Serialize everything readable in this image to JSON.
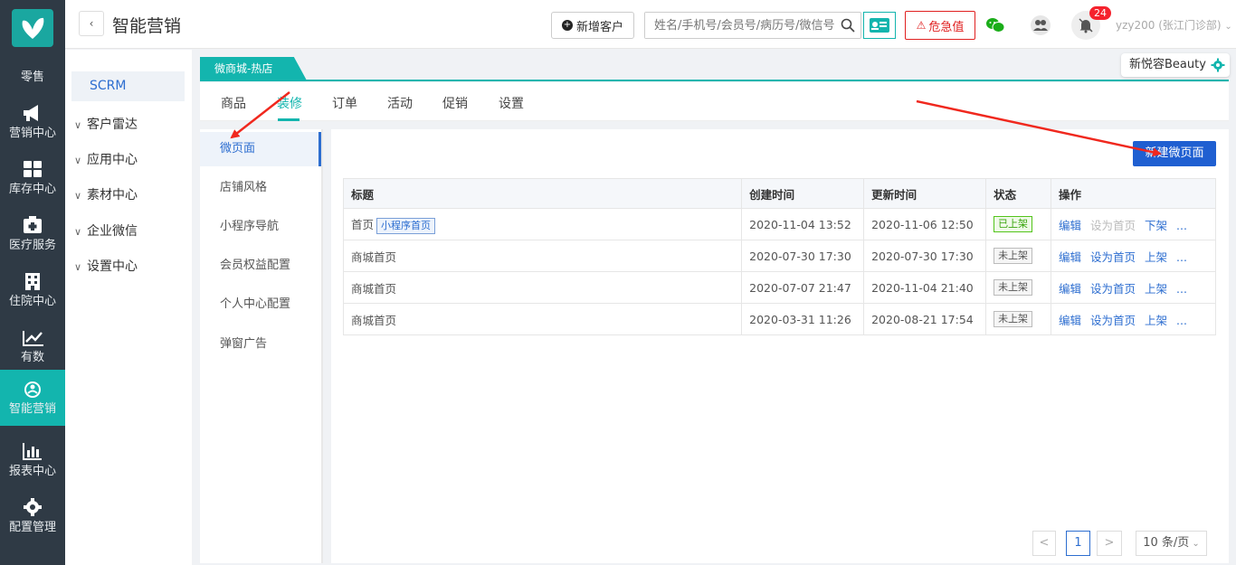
{
  "leftnav": [
    {
      "label": "零售",
      "icon": "retail-icon"
    },
    {
      "label": "营销中心",
      "icon": "megaphone-icon"
    },
    {
      "label": "库存中心",
      "icon": "grid-icon"
    },
    {
      "label": "医疗服务",
      "icon": "medical-kit-icon"
    },
    {
      "label": "住院中心",
      "icon": "building-icon"
    },
    {
      "label": "有数",
      "icon": "trend-icon"
    },
    {
      "label": "智能营销",
      "icon": "smart-marketing-icon"
    },
    {
      "label": "报表中心",
      "icon": "bar-chart-icon"
    },
    {
      "label": "配置管理",
      "icon": "gear-icon"
    }
  ],
  "header": {
    "title": "智能营销",
    "new_customer": "新增客户",
    "search_placeholder": "姓名/手机号/会员号/病历号/微信号",
    "danger_label": "危急值",
    "notification_count": "24",
    "user": "yzy200 (张江门诊部)"
  },
  "subnav": {
    "active": "SCRM",
    "items": [
      "客户雷达",
      "应用中心",
      "素材中心",
      "企业微信",
      "设置中心"
    ]
  },
  "store_tab": "微商城-热店",
  "brand": "新悦容Beauty",
  "tabs": [
    "商品",
    "装修",
    "订单",
    "活动",
    "促销",
    "设置"
  ],
  "submenu": [
    "微页面",
    "店铺风格",
    "小程序导航",
    "会员权益配置",
    "个人中心配置",
    "弹窗广告"
  ],
  "new_page_button": "新建微页面",
  "table": {
    "headers": [
      "标题",
      "创建时间",
      "更新时间",
      "状态",
      "操作"
    ],
    "rows": [
      {
        "title": "首页",
        "tag": "小程序首页",
        "created": "2020-11-04 13:52",
        "updated": "2020-11-06 12:50",
        "status": "已上架",
        "op1": "编辑",
        "op2": "设为首页",
        "op3": "下架",
        "more": "..."
      },
      {
        "title": "商城首页",
        "tag": "",
        "created": "2020-07-30 17:30",
        "updated": "2020-07-30 17:30",
        "status": "未上架",
        "op1": "编辑",
        "op2": "设为首页",
        "op3": "上架",
        "more": "..."
      },
      {
        "title": "商城首页",
        "tag": "",
        "created": "2020-07-07 21:47",
        "updated": "2020-11-04 21:40",
        "status": "未上架",
        "op1": "编辑",
        "op2": "设为首页",
        "op3": "上架",
        "more": "..."
      },
      {
        "title": "商城首页",
        "tag": "",
        "created": "2020-03-31 11:26",
        "updated": "2020-08-21 17:54",
        "status": "未上架",
        "op1": "编辑",
        "op2": "设为首页",
        "op3": "上架",
        "more": "..."
      }
    ]
  },
  "pagination": {
    "prev": "<",
    "current": "1",
    "next": ">",
    "page_size": "10 条/页"
  },
  "colors": {
    "teal": "#13b5ae",
    "sidebar": "#2f3a45",
    "primary": "#1f5fd1",
    "danger": "#e02020"
  }
}
